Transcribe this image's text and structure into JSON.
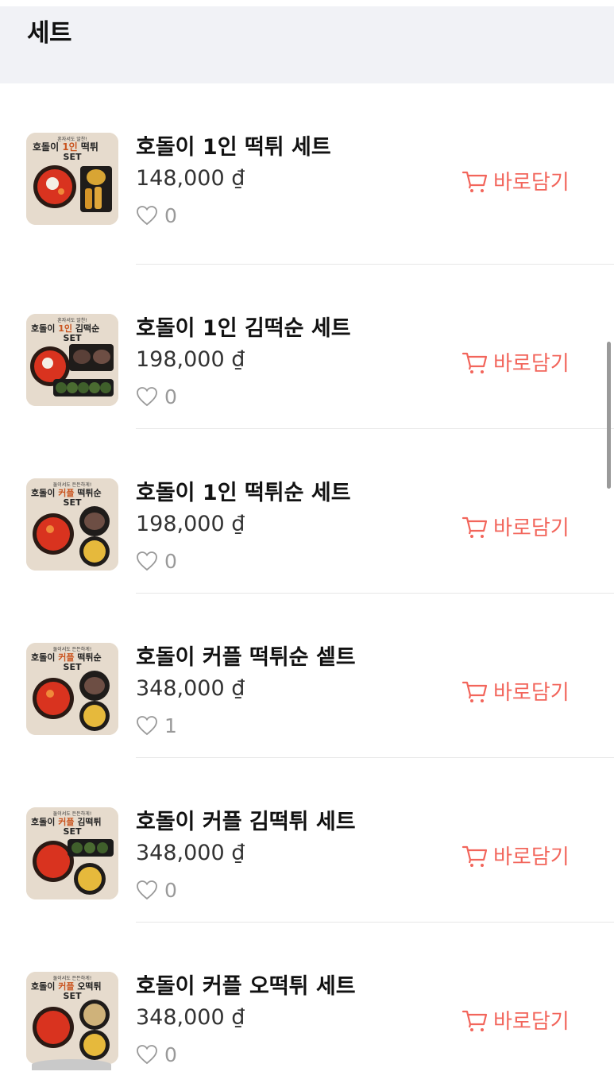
{
  "header": {
    "title": "세트"
  },
  "cart_label": "바로담기",
  "accent_color": "#f2655b",
  "products": [
    {
      "name": "호돌이 1인 떡튀 세트",
      "price": "148,000 ₫",
      "likes": "0",
      "thumb": {
        "top": "혼자서도 알찬!",
        "title_a": "호돌이",
        "title_b": "1인",
        "title_c": "떡튀",
        "set": "SET"
      }
    },
    {
      "name": "호돌이 1인 김떡순 세트",
      "price": "198,000 ₫",
      "likes": "0",
      "thumb": {
        "top": "혼자서도 알찬!",
        "title_a": "호돌이",
        "title_b": "1인",
        "title_c": "김떡순",
        "set": "SET"
      }
    },
    {
      "name": "호돌이 1인 떡튀순 세트",
      "price": "198,000 ₫",
      "likes": "0",
      "thumb": {
        "top": "둘이서도 든든하게!",
        "title_a": "호돌이",
        "title_b": "커플",
        "title_c": "떡튀순",
        "set": "SET"
      }
    },
    {
      "name": "호돌이 커플 떡튀순 셑트",
      "price": "348,000 ₫",
      "likes": "1",
      "thumb": {
        "top": "둘이서도 든든하게!",
        "title_a": "호돌이",
        "title_b": "커플",
        "title_c": "떡튀순",
        "set": "SET"
      }
    },
    {
      "name": "호돌이 커플 김떡튀 세트",
      "price": "348,000 ₫",
      "likes": "0",
      "thumb": {
        "top": "둘이서도 든든하게!",
        "title_a": "호돌이",
        "title_b": "커플",
        "title_c": "김떡튀",
        "set": "SET"
      }
    },
    {
      "name": "호돌이 커플 오떡튀 세트",
      "price": "348,000 ₫",
      "likes": "0",
      "thumb": {
        "top": "둘이서도 든든하게!",
        "title_a": "호돌이",
        "title_b": "커플",
        "title_c": "오떡튀",
        "set": "SET"
      }
    }
  ]
}
